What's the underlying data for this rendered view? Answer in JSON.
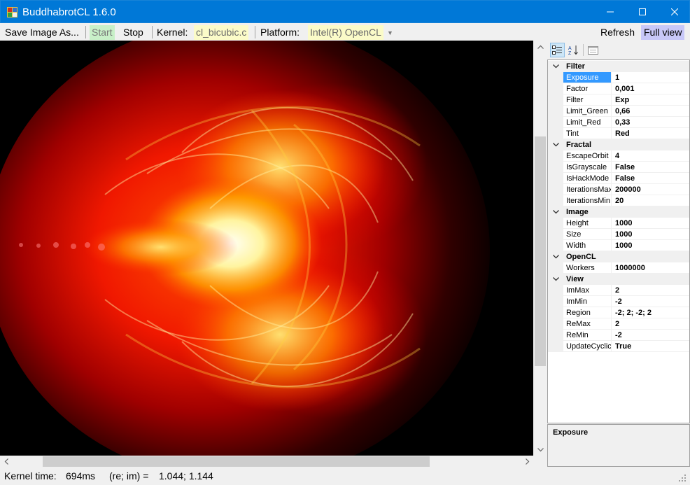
{
  "window": {
    "title": "BuddhabrotCL 1.6.0"
  },
  "toolbar": {
    "save_image": "Save Image As...",
    "start": "Start",
    "stop": "Stop",
    "kernel_label": "Kernel:",
    "kernel_value": "cl_bicubic.c",
    "platform_label": "Platform:",
    "platform_value": "Intel(R) OpenCL",
    "refresh": "Refresh",
    "full_view": "Full view"
  },
  "property_grid": {
    "categories": [
      {
        "name": "Filter",
        "props": [
          {
            "name": "Exposure",
            "value": "1"
          },
          {
            "name": "Factor",
            "value": "0,001"
          },
          {
            "name": "Filter",
            "value": "Exp"
          },
          {
            "name": "Limit_Green",
            "value": "0,66"
          },
          {
            "name": "Limit_Red",
            "value": "0,33"
          },
          {
            "name": "Tint",
            "value": "Red"
          }
        ]
      },
      {
        "name": "Fractal",
        "props": [
          {
            "name": "EscapeOrbit",
            "value": "4"
          },
          {
            "name": "IsGrayscale",
            "value": "False"
          },
          {
            "name": "IsHackMode",
            "value": "False"
          },
          {
            "name": "IterationsMax",
            "value": "200000"
          },
          {
            "name": "IterationsMin",
            "value": "20"
          }
        ]
      },
      {
        "name": "Image",
        "props": [
          {
            "name": "Height",
            "value": "1000"
          },
          {
            "name": "Size",
            "value": "1000"
          },
          {
            "name": "Width",
            "value": "1000"
          }
        ]
      },
      {
        "name": "OpenCL",
        "props": [
          {
            "name": "Workers",
            "value": "1000000"
          }
        ]
      },
      {
        "name": "View",
        "props": [
          {
            "name": "ImMax",
            "value": "2"
          },
          {
            "name": "ImMin",
            "value": "-2"
          },
          {
            "name": "Region",
            "value": "-2; 2; -2; 2"
          },
          {
            "name": "ReMax",
            "value": "2"
          },
          {
            "name": "ReMin",
            "value": "-2"
          },
          {
            "name": "UpdateCyclic",
            "value": "True"
          }
        ]
      }
    ],
    "selected": "Exposure",
    "description_title": "Exposure"
  },
  "status": {
    "kernel_time_label": "Kernel time:",
    "kernel_time_value": "694ms",
    "coords_label": "(re; im) =",
    "coords_value": "1.044; 1.144"
  },
  "colors": {
    "titlebar": "#0078d7",
    "start_bg": "#c8f0c8",
    "combo_bg": "#fbfbc8",
    "full_view_bg": "#c8c8f8",
    "selection": "#3399ff"
  },
  "icons": [
    "app-icon",
    "minimize-icon",
    "maximize-icon",
    "close-icon",
    "dropdown-arrow-icon",
    "categorized-icon",
    "alphabetical-icon",
    "property-pages-icon",
    "collapse-icon",
    "scroll-up-icon",
    "scroll-down-icon",
    "scroll-left-icon",
    "scroll-right-icon",
    "size-grip-icon"
  ]
}
